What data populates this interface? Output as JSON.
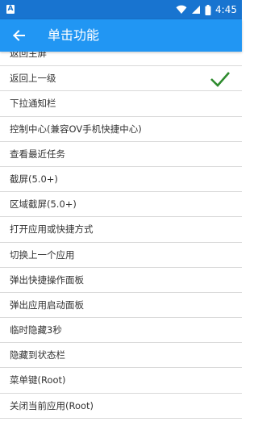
{
  "status_bar": {
    "left_icon_letter": "A",
    "icons": [
      "wifi-icon",
      "signal-icon",
      "battery-icon"
    ],
    "time": "4:45"
  },
  "app_bar": {
    "back_icon": "arrow-back-icon",
    "title": "单击功能"
  },
  "colors": {
    "status_bar": "#1874d0",
    "app_bar": "#2196f3",
    "check": "#2e8b2e"
  },
  "list": {
    "items": [
      {
        "label": "返回主屏",
        "selected": false
      },
      {
        "label": "返回上一级",
        "selected": true
      },
      {
        "label": "下拉通知栏",
        "selected": false
      },
      {
        "label": "控制中心(兼容OV手机快捷中心)",
        "selected": false
      },
      {
        "label": "查看最近任务",
        "selected": false
      },
      {
        "label": "截屏(5.0+)",
        "selected": false
      },
      {
        "label": "区域截屏(5.0+)",
        "selected": false
      },
      {
        "label": "打开应用或快捷方式",
        "selected": false
      },
      {
        "label": "切换上一个应用",
        "selected": false
      },
      {
        "label": "弹出快捷操作面板",
        "selected": false
      },
      {
        "label": "弹出应用启动面板",
        "selected": false
      },
      {
        "label": "临时隐藏3秒",
        "selected": false
      },
      {
        "label": "隐藏到状态栏",
        "selected": false
      },
      {
        "label": "菜单键(Root)",
        "selected": false
      },
      {
        "label": "关闭当前应用(Root)",
        "selected": false
      }
    ]
  }
}
